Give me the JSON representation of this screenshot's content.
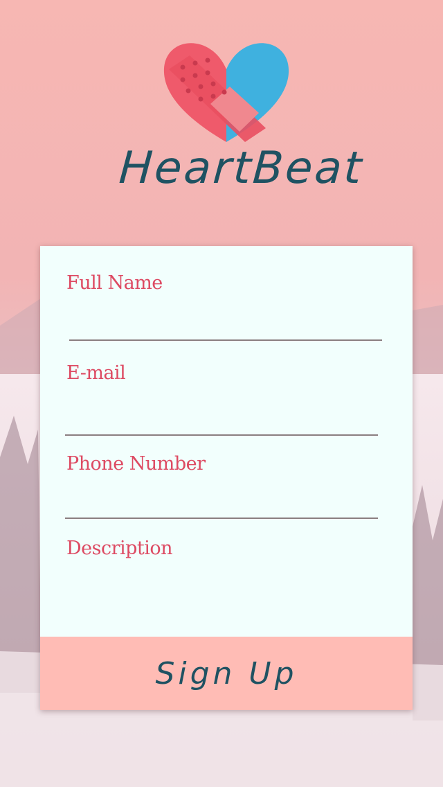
{
  "app": {
    "title": "HeartBeat"
  },
  "form": {
    "full_name_label": "Full Name",
    "full_name_value": "",
    "email_label": "E-mail",
    "email_value": "",
    "phone_label": "Phone Number",
    "phone_value": "",
    "description_label": "Description",
    "description_value": "",
    "signup_label": "Sign Up"
  },
  "colors": {
    "accent_text": "#dd4a62",
    "title_text": "#1f5262",
    "card_background": "#f2fffd",
    "button_background": "#ffbcb5",
    "heart_left": "#ef5a6b",
    "heart_right": "#3fb1df"
  },
  "icons": {
    "logo": "bandaged-heart-icon"
  }
}
